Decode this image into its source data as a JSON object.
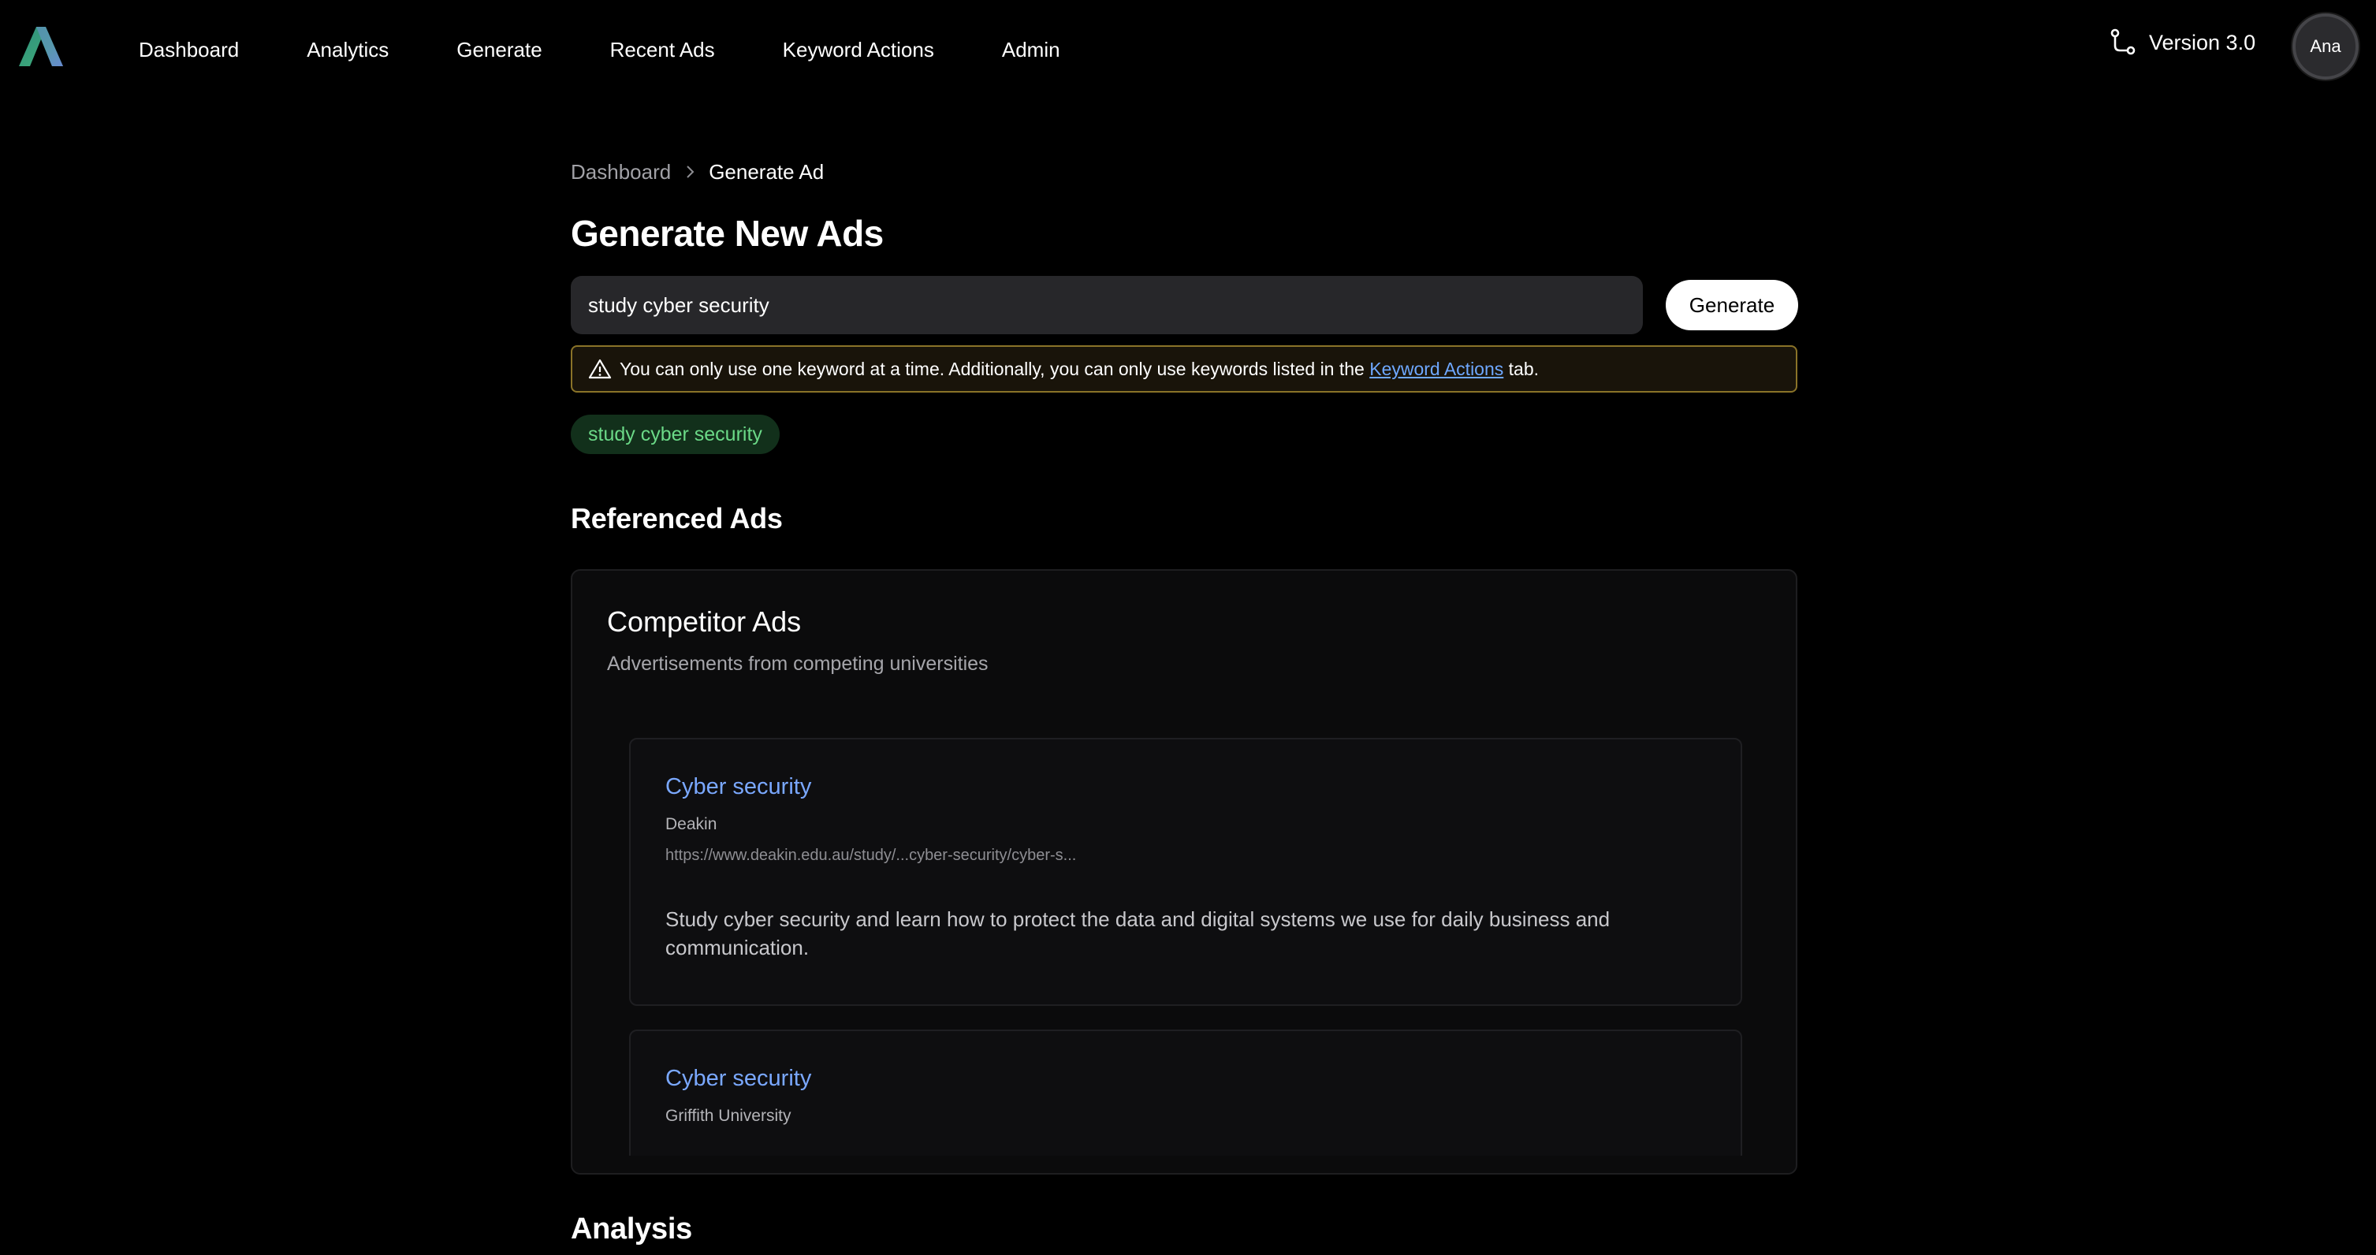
{
  "nav": {
    "items": [
      {
        "label": "Dashboard"
      },
      {
        "label": "Analytics"
      },
      {
        "label": "Generate"
      },
      {
        "label": "Recent Ads"
      },
      {
        "label": "Keyword Actions"
      },
      {
        "label": "Admin"
      }
    ],
    "version_label": "Version 3.0",
    "avatar_initials": "Ana"
  },
  "breadcrumb": {
    "parent": "Dashboard",
    "current": "Generate Ad"
  },
  "page_title": "Generate New Ads",
  "search": {
    "value": "study cyber security"
  },
  "generate_button": "Generate",
  "alert": {
    "text_before": "You can only use one keyword at a time. Additionally, you can only use keywords listed in the",
    "link": "Keyword Actions",
    "text_after": "tab."
  },
  "keyword_chip": "study cyber security",
  "referenced_title": "Referenced Ads",
  "competitor": {
    "title": "Competitor Ads",
    "subtitle": "Advertisements from competing universities",
    "ads": [
      {
        "title": "Cyber security",
        "brand": "Deakin",
        "url": "https://www.deakin.edu.au/study/...cyber-security/cyber-s...",
        "description": "Study cyber security and learn how to protect the data and digital systems we use for daily business and communication."
      },
      {
        "title": "Cyber security",
        "brand": "Griffith University"
      }
    ]
  },
  "analysis_title": "Analysis",
  "colors": {
    "background": "#000000",
    "link": "#7aa8ff",
    "chip_text": "#6bd987",
    "alert_border": "#8a7328"
  }
}
